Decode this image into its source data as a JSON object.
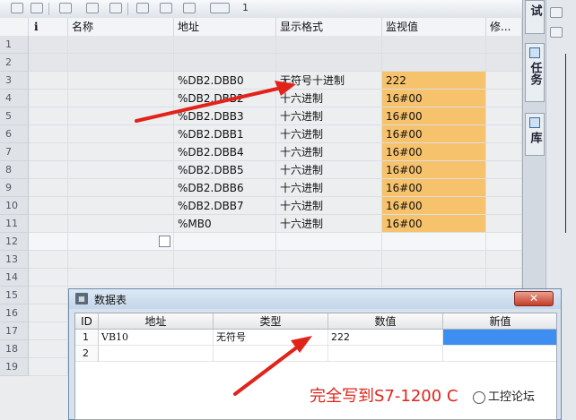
{
  "toolbar": {
    "counter": "1"
  },
  "table": {
    "headers": {
      "info": "i",
      "name": "名称",
      "address": "地址",
      "format": "显示格式",
      "monitor": "监视值",
      "modify": "修..."
    },
    "rows": [
      {
        "n": "1",
        "address": "",
        "format": "",
        "monitor": ""
      },
      {
        "n": "2",
        "address": "",
        "format": "",
        "monitor": ""
      },
      {
        "n": "3",
        "address": "%DB2.DBB0",
        "format": "无符号十进制",
        "monitor": "222"
      },
      {
        "n": "4",
        "address": "%DB2.DBB2",
        "format": "十六进制",
        "monitor": "16#00"
      },
      {
        "n": "5",
        "address": "%DB2.DBB3",
        "format": "十六进制",
        "monitor": "16#00"
      },
      {
        "n": "6",
        "address": "%DB2.DBB1",
        "format": "十六进制",
        "monitor": "16#00"
      },
      {
        "n": "7",
        "address": "%DB2.DBB4",
        "format": "十六进制",
        "monitor": "16#00"
      },
      {
        "n": "8",
        "address": "%DB2.DBB5",
        "format": "十六进制",
        "monitor": "16#00"
      },
      {
        "n": "9",
        "address": "%DB2.DBB6",
        "format": "十六进制",
        "monitor": "16#00"
      },
      {
        "n": "10",
        "address": "%DB2.DBB7",
        "format": "十六进制",
        "monitor": "16#00"
      },
      {
        "n": "11",
        "address": "%MB0",
        "format": "十六进制",
        "monitor": "16#00"
      },
      {
        "n": "12",
        "address": "",
        "format": "",
        "monitor": ""
      },
      {
        "n": "13",
        "address": "",
        "format": "",
        "monitor": ""
      },
      {
        "n": "14",
        "address": "",
        "format": "",
        "monitor": ""
      },
      {
        "n": "15",
        "address": "",
        "format": "",
        "monitor": ""
      },
      {
        "n": "16",
        "address": "",
        "format": "",
        "monitor": ""
      },
      {
        "n": "17",
        "address": "",
        "format": "",
        "monitor": ""
      },
      {
        "n": "18",
        "address": "",
        "format": "",
        "monitor": ""
      },
      {
        "n": "19",
        "address": "",
        "format": "",
        "monitor": ""
      }
    ]
  },
  "sidebar": {
    "tab_test": "试",
    "tab_tasks": "任务",
    "tab_library": "库"
  },
  "dialog": {
    "title": "数据表",
    "close_label": "✕",
    "headers": {
      "id": "ID",
      "address": "地址",
      "type": "类型",
      "value": "数值",
      "new_value": "新值"
    },
    "rows": [
      {
        "id": "1",
        "address": "VB10",
        "type": "无符号",
        "value": "222",
        "new_value": ""
      },
      {
        "id": "2",
        "address": "",
        "type": "",
        "value": "",
        "new_value": ""
      }
    ]
  },
  "annotation": {
    "caption": "完全写到S7-1200 ",
    "caption_tail": "C"
  },
  "watermark": "工控论坛",
  "colors": {
    "monitor_bg": "#f7c26c",
    "arrow": "#e2231a",
    "selected": "#3d8ef0"
  }
}
